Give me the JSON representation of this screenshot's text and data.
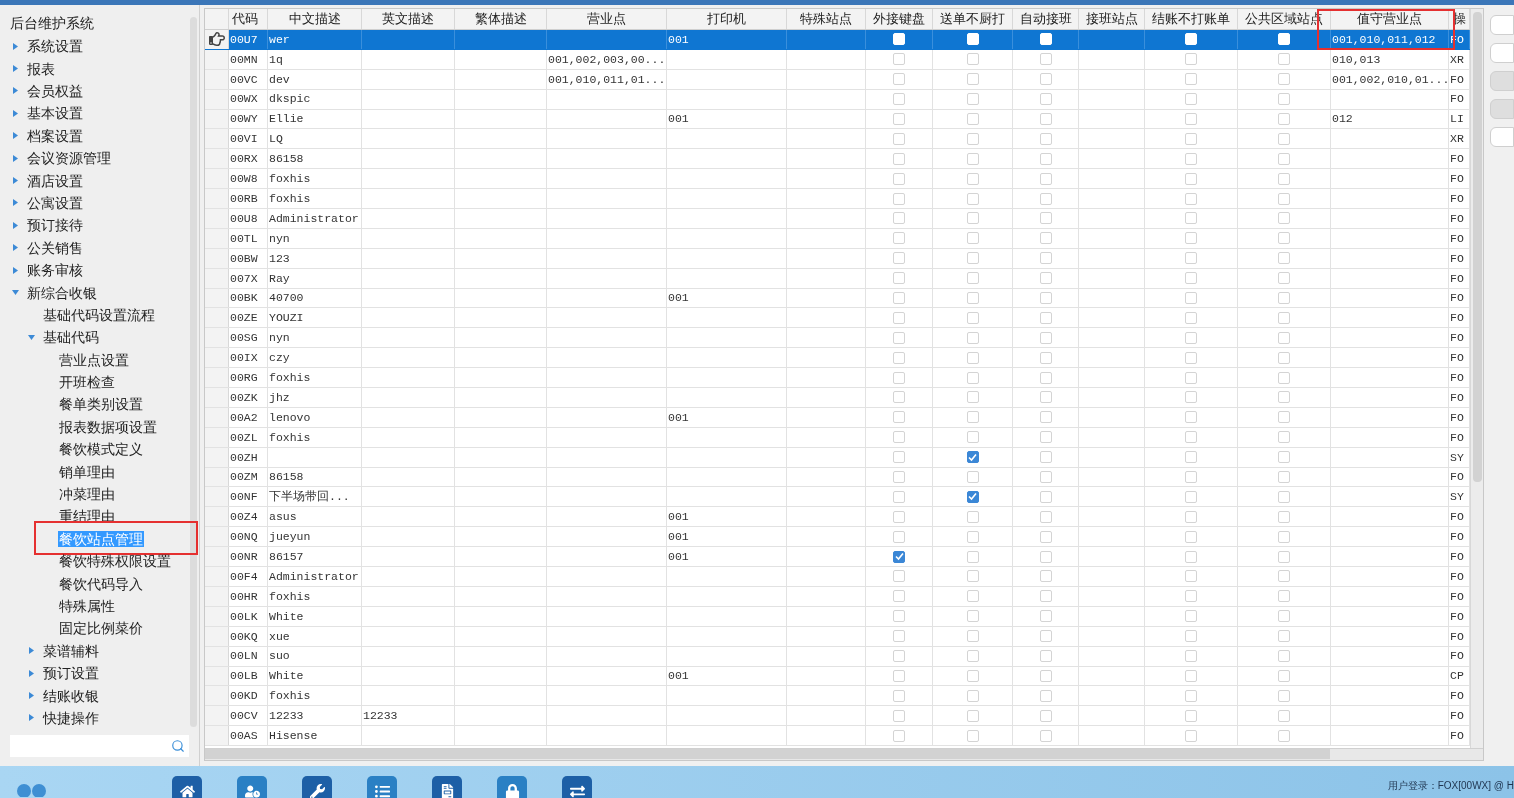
{
  "sidebar": {
    "title": "后台维护系统",
    "items": [
      {
        "label": "系统设置",
        "expanded": false,
        "selected": false
      },
      {
        "label": "报表",
        "expanded": false,
        "selected": false
      },
      {
        "label": "会员权益",
        "expanded": false,
        "selected": false
      },
      {
        "label": "基本设置",
        "expanded": false,
        "selected": false
      },
      {
        "label": "档案设置",
        "expanded": false,
        "selected": false
      },
      {
        "label": "会议资源管理",
        "expanded": false,
        "selected": false
      },
      {
        "label": "酒店设置",
        "expanded": false,
        "selected": false
      },
      {
        "label": "公寓设置",
        "expanded": false,
        "selected": false
      },
      {
        "label": "预订接待",
        "expanded": false,
        "selected": false
      },
      {
        "label": "公关销售",
        "expanded": false,
        "selected": false
      },
      {
        "label": "账务审核",
        "expanded": false,
        "selected": false
      },
      {
        "label": "新综合收银",
        "expanded": true,
        "selected": false,
        "children": [
          {
            "label": "基础代码设置流程",
            "selected": false
          },
          {
            "label": "基础代码",
            "expanded": true,
            "selected": false,
            "children": [
              {
                "label": "营业点设置",
                "selected": false
              },
              {
                "label": "开班检查",
                "selected": false
              },
              {
                "label": "餐单类别设置",
                "selected": false
              },
              {
                "label": "报表数据项设置",
                "selected": false
              },
              {
                "label": "餐饮模式定义",
                "selected": false
              },
              {
                "label": "销单理由",
                "selected": false
              },
              {
                "label": "冲菜理由",
                "selected": false
              },
              {
                "label": "重结理由",
                "selected": false
              },
              {
                "label": "餐饮站点管理",
                "selected": true,
                "marked": true
              },
              {
                "label": "餐饮特殊权限设置",
                "selected": false
              },
              {
                "label": "餐饮代码导入",
                "selected": false
              },
              {
                "label": "特殊属性",
                "selected": false
              },
              {
                "label": "固定比例菜价",
                "selected": false
              }
            ]
          },
          {
            "label": "菜谱辅料",
            "expanded": false,
            "selected": false
          },
          {
            "label": "预订设置",
            "expanded": false,
            "selected": false
          },
          {
            "label": "结账收银",
            "expanded": false,
            "selected": false
          },
          {
            "label": "快捷操作",
            "expanded": false,
            "selected": false
          }
        ]
      }
    ]
  },
  "table": {
    "columns": [
      {
        "label": "代码",
        "kind": "text"
      },
      {
        "label": "中文描述",
        "kind": "text"
      },
      {
        "label": "英文描述",
        "kind": "text"
      },
      {
        "label": "繁体描述",
        "kind": "text"
      },
      {
        "label": "营业点",
        "kind": "text"
      },
      {
        "label": "打印机",
        "kind": "text"
      },
      {
        "label": "特殊站点",
        "kind": "text"
      },
      {
        "label": "外接键盘",
        "kind": "check"
      },
      {
        "label": "送单不厨打",
        "kind": "check"
      },
      {
        "label": "自动接班",
        "kind": "check"
      },
      {
        "label": "接班站点",
        "kind": "text"
      },
      {
        "label": "结账不打账单",
        "kind": "check"
      },
      {
        "label": "公共区域站点",
        "kind": "check"
      },
      {
        "label": "值守营业点",
        "kind": "text",
        "marked": true
      },
      {
        "label": "操",
        "kind": "text"
      }
    ],
    "rows": [
      {
        "selected": true,
        "cells": [
          "00U7",
          "wer",
          null,
          null,
          null,
          "001",
          null,
          false,
          false,
          false,
          null,
          false,
          false,
          "001,010,011,012",
          "FO"
        ]
      },
      {
        "selected": false,
        "cells": [
          "00MN",
          "1q",
          null,
          null,
          "001,002,003,00...",
          null,
          null,
          false,
          false,
          false,
          null,
          false,
          false,
          "010,013",
          "XR"
        ]
      },
      {
        "selected": false,
        "cells": [
          "00VC",
          "dev",
          null,
          null,
          "001,010,011,01...",
          null,
          null,
          false,
          false,
          false,
          null,
          false,
          false,
          "001,002,010,01...",
          "FO"
        ]
      },
      {
        "selected": false,
        "cells": [
          "00WX",
          "dkspic",
          null,
          null,
          null,
          null,
          null,
          false,
          false,
          false,
          null,
          false,
          false,
          null,
          "FO"
        ]
      },
      {
        "selected": false,
        "cells": [
          "00WY",
          "Ellie",
          null,
          null,
          null,
          "001",
          null,
          false,
          false,
          false,
          null,
          false,
          false,
          "012",
          "LI"
        ]
      },
      {
        "selected": false,
        "cells": [
          "00VI",
          "LQ",
          null,
          null,
          null,
          null,
          null,
          false,
          false,
          false,
          null,
          false,
          false,
          null,
          "XR"
        ]
      },
      {
        "selected": false,
        "cells": [
          "00RX",
          "86158",
          null,
          null,
          null,
          null,
          null,
          false,
          false,
          false,
          null,
          false,
          false,
          null,
          "FO"
        ]
      },
      {
        "selected": false,
        "cells": [
          "00W8",
          "foxhis",
          null,
          null,
          null,
          null,
          null,
          false,
          false,
          false,
          null,
          false,
          false,
          null,
          "FO"
        ]
      },
      {
        "selected": false,
        "cells": [
          "00RB",
          "foxhis",
          null,
          null,
          null,
          null,
          null,
          false,
          false,
          false,
          null,
          false,
          false,
          null,
          "FO"
        ]
      },
      {
        "selected": false,
        "cells": [
          "00U8",
          "Administrator",
          null,
          null,
          null,
          null,
          null,
          false,
          false,
          false,
          null,
          false,
          false,
          null,
          "FO"
        ]
      },
      {
        "selected": false,
        "cells": [
          "00TL",
          "nyn",
          null,
          null,
          null,
          null,
          null,
          false,
          false,
          false,
          null,
          false,
          false,
          null,
          "FO"
        ]
      },
      {
        "selected": false,
        "cells": [
          "00BW",
          "123",
          null,
          null,
          null,
          null,
          null,
          false,
          false,
          false,
          null,
          false,
          false,
          null,
          "FO"
        ]
      },
      {
        "selected": false,
        "cells": [
          "007X",
          "Ray",
          null,
          null,
          null,
          null,
          null,
          false,
          false,
          false,
          null,
          false,
          false,
          null,
          "FO"
        ]
      },
      {
        "selected": false,
        "cells": [
          "00BK",
          "40700",
          null,
          null,
          null,
          "001",
          null,
          false,
          false,
          false,
          null,
          false,
          false,
          null,
          "FO"
        ]
      },
      {
        "selected": false,
        "cells": [
          "00ZE",
          "YOUZI",
          null,
          null,
          null,
          null,
          null,
          false,
          false,
          false,
          null,
          false,
          false,
          null,
          "FO"
        ]
      },
      {
        "selected": false,
        "cells": [
          "00SG",
          "nyn",
          null,
          null,
          null,
          null,
          null,
          false,
          false,
          false,
          null,
          false,
          false,
          null,
          "FO"
        ]
      },
      {
        "selected": false,
        "cells": [
          "00IX",
          "czy",
          null,
          null,
          null,
          null,
          null,
          false,
          false,
          false,
          null,
          false,
          false,
          null,
          "FO"
        ]
      },
      {
        "selected": false,
        "cells": [
          "00RG",
          "foxhis",
          null,
          null,
          null,
          null,
          null,
          false,
          false,
          false,
          null,
          false,
          false,
          null,
          "FO"
        ]
      },
      {
        "selected": false,
        "cells": [
          "00ZK",
          "jhz",
          null,
          null,
          null,
          null,
          null,
          false,
          false,
          false,
          null,
          false,
          false,
          null,
          "FO"
        ]
      },
      {
        "selected": false,
        "cells": [
          "00A2",
          "lenovo",
          null,
          null,
          null,
          "001",
          null,
          false,
          false,
          false,
          null,
          false,
          false,
          null,
          "FO"
        ]
      },
      {
        "selected": false,
        "cells": [
          "00ZL",
          "foxhis",
          null,
          null,
          null,
          null,
          null,
          false,
          false,
          false,
          null,
          false,
          false,
          null,
          "FO"
        ]
      },
      {
        "selected": false,
        "cells": [
          "00ZH",
          null,
          null,
          null,
          null,
          null,
          null,
          false,
          true,
          false,
          null,
          false,
          false,
          null,
          "SY"
        ]
      },
      {
        "selected": false,
        "cells": [
          "00ZM",
          "86158",
          null,
          null,
          null,
          null,
          null,
          false,
          false,
          false,
          null,
          false,
          false,
          null,
          "FO"
        ]
      },
      {
        "selected": false,
        "cells": [
          "00NF",
          "下半场带回...",
          null,
          null,
          null,
          null,
          null,
          false,
          true,
          false,
          null,
          false,
          false,
          null,
          "SY"
        ]
      },
      {
        "selected": false,
        "cells": [
          "00Z4",
          "asus",
          null,
          null,
          null,
          "001",
          null,
          false,
          false,
          false,
          null,
          false,
          false,
          null,
          "FO"
        ]
      },
      {
        "selected": false,
        "cells": [
          "00NQ",
          "jueyun",
          null,
          null,
          null,
          "001",
          null,
          false,
          false,
          false,
          null,
          false,
          false,
          null,
          "FO"
        ]
      },
      {
        "selected": false,
        "cells": [
          "00NR",
          "86157",
          null,
          null,
          null,
          "001",
          null,
          true,
          false,
          false,
          null,
          false,
          false,
          null,
          "FO"
        ]
      },
      {
        "selected": false,
        "cells": [
          "00F4",
          "Administrator",
          null,
          null,
          null,
          null,
          null,
          false,
          false,
          false,
          null,
          false,
          false,
          null,
          "FO"
        ]
      },
      {
        "selected": false,
        "cells": [
          "00HR",
          "foxhis",
          null,
          null,
          null,
          null,
          null,
          false,
          false,
          false,
          null,
          false,
          false,
          null,
          "FO"
        ]
      },
      {
        "selected": false,
        "cells": [
          "00LK",
          "White",
          null,
          null,
          null,
          null,
          null,
          false,
          false,
          false,
          null,
          false,
          false,
          null,
          "FO"
        ]
      },
      {
        "selected": false,
        "cells": [
          "00KQ",
          "xue",
          null,
          null,
          null,
          null,
          null,
          false,
          false,
          false,
          null,
          false,
          false,
          null,
          "FO"
        ]
      },
      {
        "selected": false,
        "cells": [
          "00LN",
          "suo",
          null,
          null,
          null,
          null,
          null,
          false,
          false,
          false,
          null,
          false,
          false,
          null,
          "FO"
        ]
      },
      {
        "selected": false,
        "cells": [
          "00LB",
          "White",
          null,
          null,
          null,
          "001",
          null,
          false,
          false,
          false,
          null,
          false,
          false,
          null,
          "CP"
        ]
      },
      {
        "selected": false,
        "cells": [
          "00KD",
          "foxhis",
          null,
          null,
          null,
          null,
          null,
          false,
          false,
          false,
          null,
          false,
          false,
          null,
          "FO"
        ]
      },
      {
        "selected": false,
        "cells": [
          "00CV",
          "12233",
          "12233",
          null,
          null,
          null,
          null,
          false,
          false,
          false,
          null,
          false,
          false,
          null,
          "FO"
        ]
      },
      {
        "selected": false,
        "cells": [
          "00AS",
          "Hisense",
          null,
          null,
          null,
          null,
          null,
          false,
          false,
          false,
          null,
          false,
          false,
          null,
          "FO"
        ]
      }
    ]
  },
  "status_bar": {
    "user_login": "用户登录：FOX[00WX] @ H"
  }
}
